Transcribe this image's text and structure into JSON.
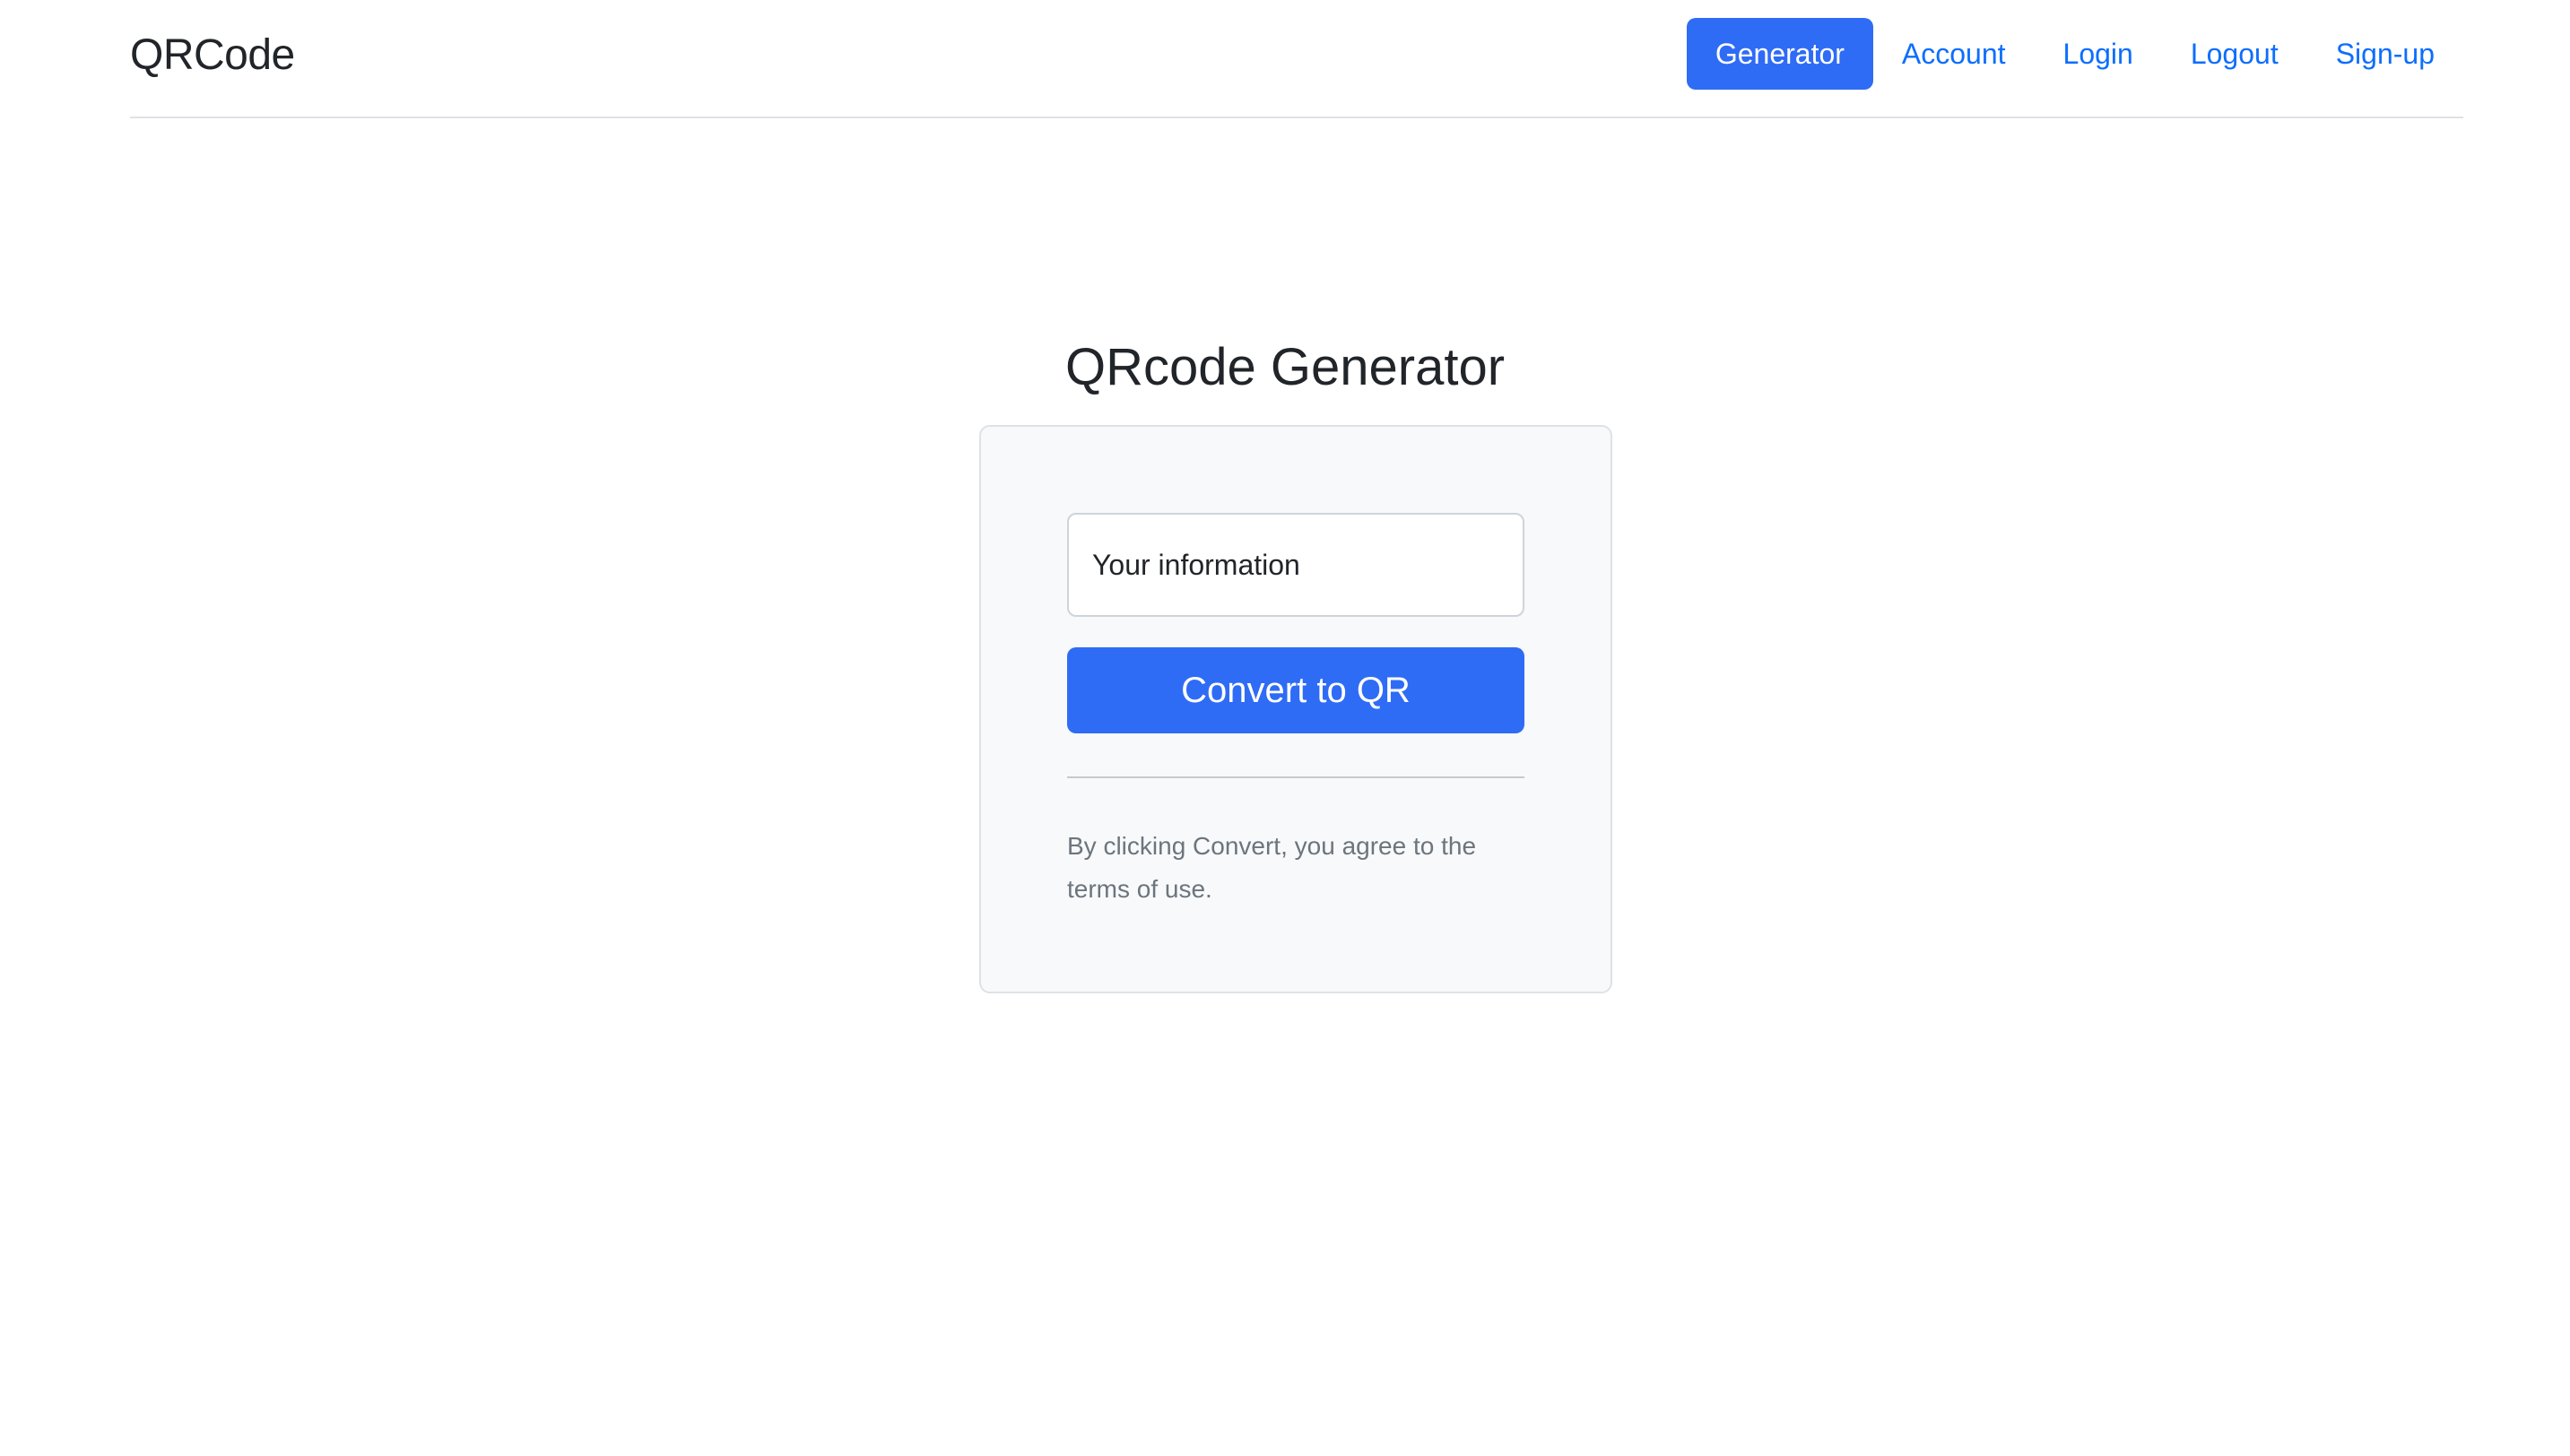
{
  "header": {
    "brand": "QRCode",
    "nav": [
      {
        "label": "Generator",
        "active": true
      },
      {
        "label": "Account",
        "active": false
      },
      {
        "label": "Login",
        "active": false
      },
      {
        "label": "Logout",
        "active": false
      },
      {
        "label": "Sign-up",
        "active": false
      }
    ]
  },
  "main": {
    "title": "QRcode Generator",
    "form": {
      "input_placeholder": "Your information",
      "input_value": "",
      "submit_label": "Convert to QR",
      "terms_text": "By clicking Convert, you agree to the terms of use."
    }
  },
  "colors": {
    "primary": "#2f6cf5",
    "link": "#0d6efd",
    "card_bg": "#f8f9fa",
    "muted_text": "#6c757d"
  }
}
